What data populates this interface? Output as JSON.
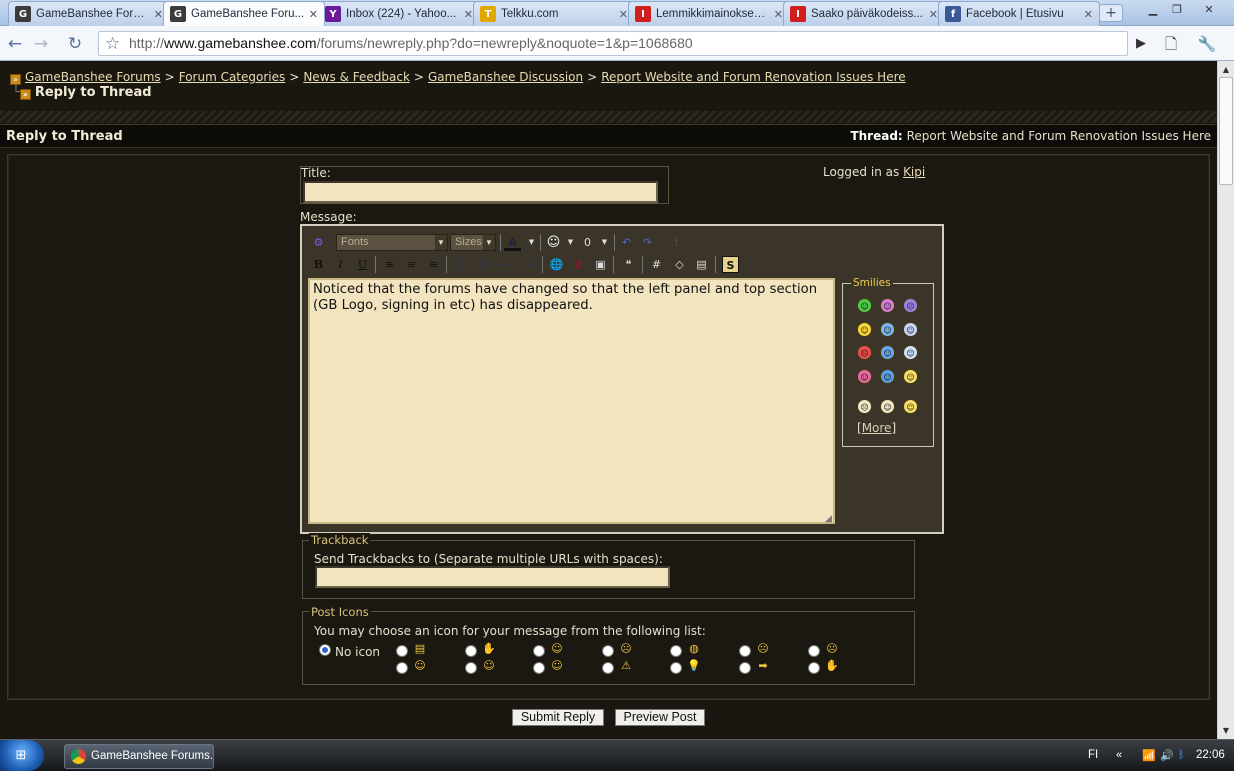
{
  "browser": {
    "tabs": [
      {
        "label": "GameBanshee Forums",
        "icon": "gamebanshee-favicon",
        "color": "#3b3b3b",
        "glyph": "GB"
      },
      {
        "label": "GameBanshee Foru...",
        "icon": "gamebanshee-favicon",
        "color": "#3b3b3b",
        "glyph": "GB"
      },
      {
        "label": "Inbox (224) - Yahoo...",
        "icon": "yahoo-favicon",
        "color": "#6a1b9a",
        "glyph": "Y!"
      },
      {
        "label": "Telkku.com",
        "icon": "telkku-favicon",
        "color": "#e0a800",
        "glyph": "T"
      },
      {
        "label": "Lemmikkimainoksess...",
        "icon": "iltalehti-favicon",
        "color": "#d21d1d",
        "glyph": "IL"
      },
      {
        "label": "Saako päiväkodeiss...",
        "icon": "iltalehti-favicon",
        "color": "#d21d1d",
        "glyph": "IL"
      },
      {
        "label": "Facebook | Etusivu",
        "icon": "facebook-favicon",
        "color": "#3b5998",
        "glyph": "f"
      }
    ],
    "new_tab": "+",
    "url_scheme": "http://",
    "url_host": "www.gamebanshee.com",
    "url_path": "/forums/newreply.php?do=newreply&noquote=1&p=1068680"
  },
  "breadcrumb": {
    "items": [
      "GameBanshee Forums",
      "Forum Categories",
      "News & Feedback",
      "GameBanshee Discussion",
      "Report Website and Forum Renovation Issues Here"
    ],
    "separator": ">",
    "current": "Reply to Thread"
  },
  "header": {
    "title": "Reply to Thread",
    "thread_label": "Thread:",
    "thread_name": "Report Website and Forum Renovation Issues Here"
  },
  "form": {
    "title_label": "Title:",
    "title_value": "",
    "logged_in_prefix": "Logged in as",
    "username": "Kipi",
    "message_label": "Message:",
    "font_dropdown": "Fonts",
    "size_dropdown": "Sizes",
    "message_text": "Noticed that the forums have changed so that the left panel and top section (GB Logo, signing in etc) has disappeared.",
    "smilies_legend": "Smilies",
    "more_link": "More",
    "more_open": "[",
    "more_close": "]",
    "trackback_legend": "Trackback",
    "trackback_label": "Send Trackbacks to (Separate multiple URLs with spaces):",
    "trackback_value": "",
    "post_icons_legend": "Post Icons",
    "post_icons_label": "You may choose an icon for your message from the following list:",
    "no_icon_label": "No icon",
    "submit_label": "Submit Reply",
    "preview_label": "Preview Post"
  },
  "toolbar_buttons": {
    "bold": "B",
    "italic": "I",
    "underline": "U"
  },
  "taskbar": {
    "task_label": "GameBanshee Forums...",
    "language": "FI",
    "clock": "22:06"
  },
  "colors": {
    "page_bg": "#1a1710",
    "link": "#e8dcb2",
    "input_bg": "#f2e4bf",
    "legend": "#d9c37a",
    "editor_bg": "#3b3429"
  }
}
